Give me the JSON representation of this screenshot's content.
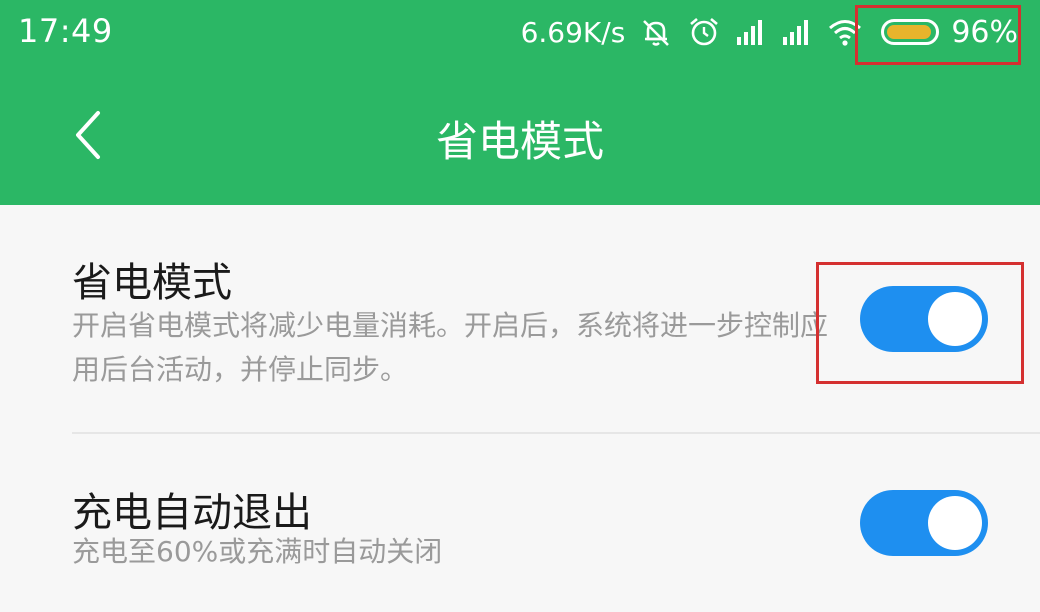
{
  "status_bar": {
    "time": "17:49",
    "net_speed": "6.69K/s",
    "battery_percent": "96%",
    "battery_level": 0.96,
    "icons": [
      "mute-bell-icon",
      "alarm-clock-icon",
      "signal-icon",
      "signal-icon",
      "wifi-icon",
      "battery-icon"
    ]
  },
  "header": {
    "title": "省电模式",
    "back_icon": "chevron-left-icon"
  },
  "settings": [
    {
      "title": "省电模式",
      "description": "开启省电模式将减少电量消耗。开启后，系统将进一步控制应用后台活动，并停止同步。",
      "enabled": true
    },
    {
      "title": "充电自动退出",
      "description": "充电至60%或充满时自动关闭",
      "enabled": true
    }
  ],
  "colors": {
    "header_bg": "#2bb765",
    "toggle_on": "#1e8ff0",
    "battery_fill": "#e8b42c",
    "highlight_box": "#d43030"
  }
}
